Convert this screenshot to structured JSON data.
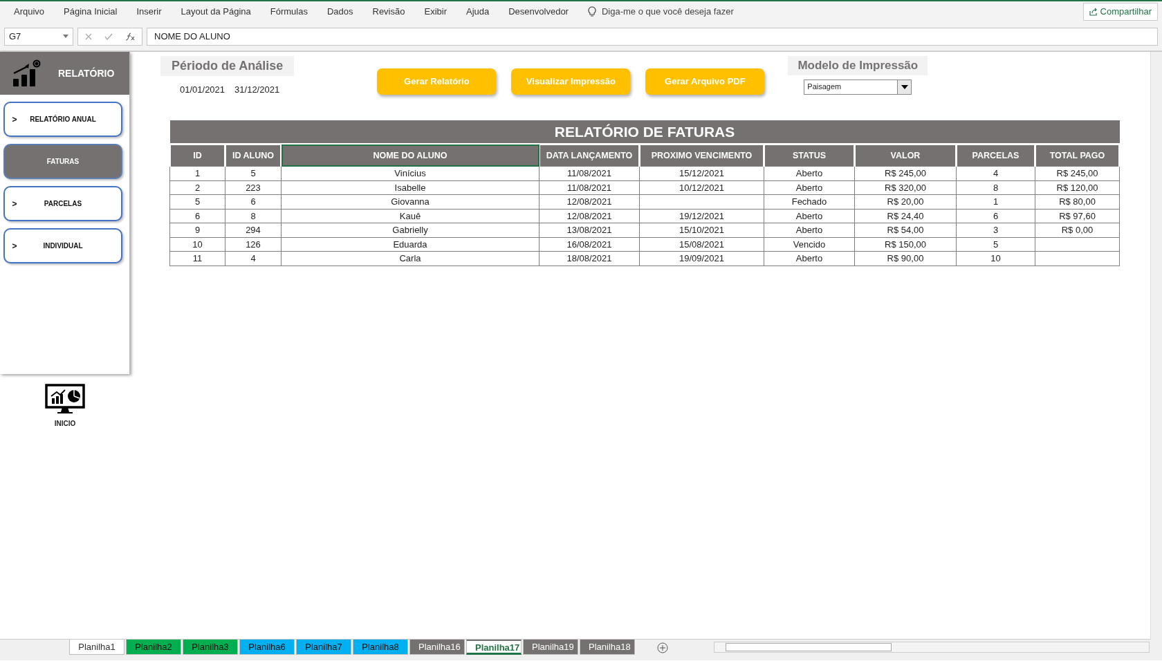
{
  "ribbon_menu": [
    "Arquivo",
    "Página Inicial",
    "Inserir",
    "Layout da Página",
    "Fórmulas",
    "Dados",
    "Revisão",
    "Exibir",
    "Ajuda",
    "Desenvolvedor"
  ],
  "tell_me": {
    "placeholder": "Diga-me o que você deseja fazer"
  },
  "share_button": "Compartilhar",
  "formula_bar": {
    "name_box": "G7",
    "formula": "NOME DO ALUNO"
  },
  "sidebar": {
    "title": "RELATÓRIO",
    "items": [
      {
        "label": "RELATÓRIO ANUAL",
        "arrow": ">",
        "selected": false
      },
      {
        "label": "FATURAS",
        "selected": true
      },
      {
        "label": "PARCELAS",
        "arrow": ">",
        "selected": false
      },
      {
        "label": "INDIVIDUAL",
        "arrow": ">",
        "selected": false
      }
    ],
    "home_label": "INICIO"
  },
  "period": {
    "title": "Périodo de Análise",
    "start": "01/01/2021",
    "end": "31/12/2021"
  },
  "buttons": [
    "Gerar Relatório",
    "Visualizar Impressão",
    "Gerar Arquivo PDF"
  ],
  "print_model": {
    "title": "Modelo de Impressão",
    "value": "Paisagem"
  },
  "table": {
    "title": "RELATÓRIO DE FATURAS",
    "columns": [
      {
        "label": "ID",
        "selected": false
      },
      {
        "label": "ID ALUNO",
        "selected": false
      },
      {
        "label": "NOME DO ALUNO",
        "selected": true
      },
      {
        "label": "DATA LANÇAMENTO",
        "selected": false
      },
      {
        "label": "PROXIMO VENCIMENTO",
        "selected": false
      },
      {
        "label": "STATUS",
        "selected": false
      },
      {
        "label": "VALOR",
        "selected": false
      },
      {
        "label": "PARCELAS",
        "selected": false
      },
      {
        "label": "TOTAL PAGO",
        "selected": false
      }
    ],
    "rows": [
      [
        "1",
        "5",
        "Vinícius",
        "11/08/2021",
        "15/12/2021",
        "Aberto",
        "R$ 245,00",
        "4",
        "R$ 245,00"
      ],
      [
        "2",
        "223",
        "Isabelle",
        "11/08/2021",
        "10/12/2021",
        "Aberto",
        "R$ 320,00",
        "8",
        "R$ 120,00"
      ],
      [
        "5",
        "6",
        "Giovanna",
        "12/08/2021",
        null,
        "Fechado",
        "R$ 20,00",
        "1",
        "R$ 80,00"
      ],
      [
        "6",
        "8",
        "Kauê",
        "12/08/2021",
        "19/12/2021",
        "Aberto",
        "R$ 24,40",
        "6",
        "R$ 97,60"
      ],
      [
        "9",
        "294",
        "Gabrielly",
        "13/08/2021",
        "15/10/2021",
        "Aberto",
        "R$ 54,00",
        "3",
        "R$ 0,00"
      ],
      [
        "10",
        "126",
        "Eduarda",
        "16/08/2021",
        "15/08/2021",
        "Vencido",
        "R$ 150,00",
        "5",
        null
      ],
      [
        "11",
        "4",
        "Carla",
        "18/08/2021",
        "19/09/2021",
        "Aberto",
        "R$ 90,00",
        "10",
        null
      ]
    ]
  },
  "sheet_tabs": [
    {
      "label": "Planilha1",
      "selected": false
    },
    {
      "label": "Planilha2",
      "color": "#00b050",
      "selected": false
    },
    {
      "label": "Planilha3",
      "color": "#00b050",
      "selected": false
    },
    {
      "label": "Planilha6",
      "color": "#00b0f0",
      "selected": false
    },
    {
      "label": "Planilha7",
      "color": "#00b0f0",
      "selected": false
    },
    {
      "label": "Planilha8",
      "color": "#00b0f0",
      "selected": false
    },
    {
      "label": "Planilha16",
      "color": "#767171",
      "selected": false
    },
    {
      "label": "Planilha17",
      "color": "#767171",
      "selected": true
    },
    {
      "label": "Planilha19",
      "color": "#767171",
      "selected": false
    },
    {
      "label": "Planilha18",
      "color": "#767171",
      "selected": false
    }
  ]
}
